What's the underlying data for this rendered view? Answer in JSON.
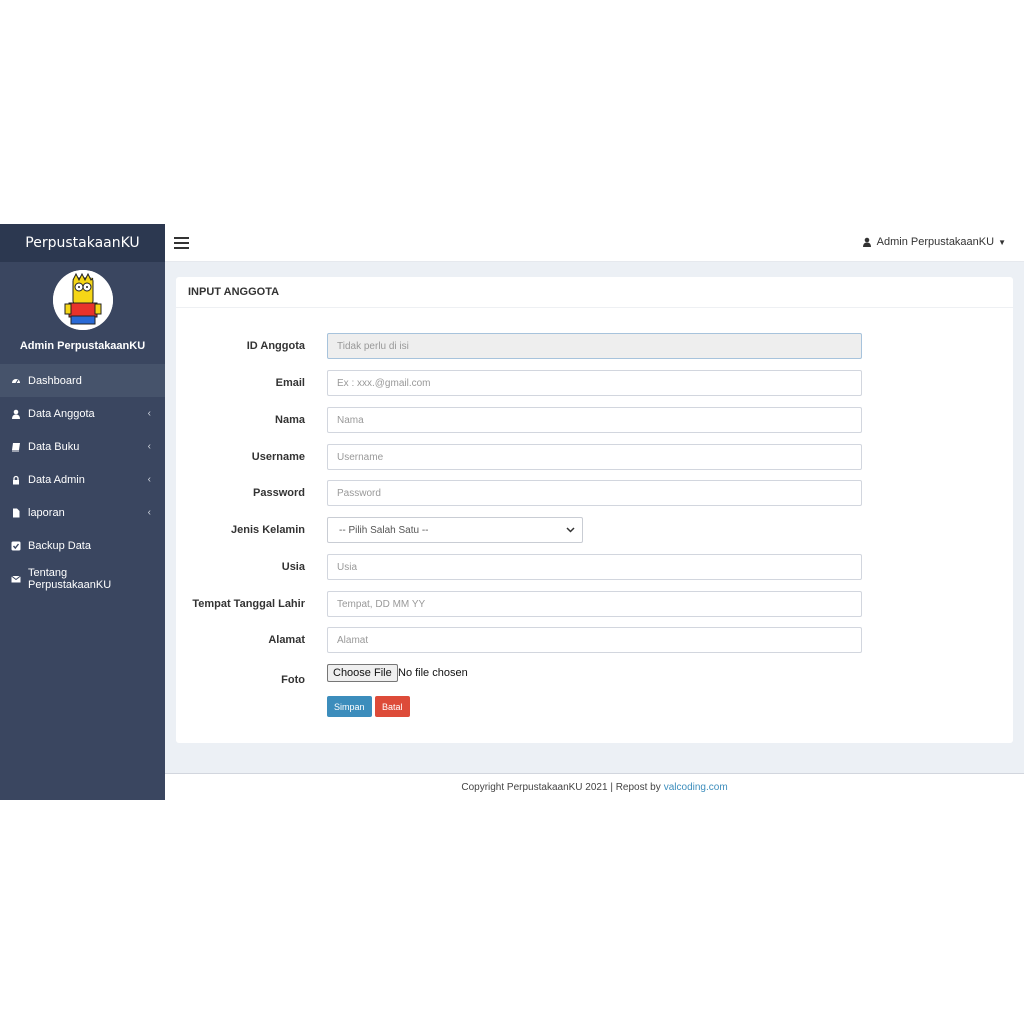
{
  "app": {
    "brand": "PerpustakaanKU"
  },
  "sidebar": {
    "user_name": "Admin PerpustakaanKU",
    "items": [
      {
        "label": "Dashboard",
        "icon": "dashboard-icon",
        "active": true,
        "submenu": false
      },
      {
        "label": "Data Anggota",
        "icon": "user-icon",
        "active": false,
        "submenu": true
      },
      {
        "label": "Data Buku",
        "icon": "book-icon",
        "active": false,
        "submenu": true
      },
      {
        "label": "Data Admin",
        "icon": "lock-icon",
        "active": false,
        "submenu": true
      },
      {
        "label": "laporan",
        "icon": "file-icon",
        "active": false,
        "submenu": true
      },
      {
        "label": "Backup Data",
        "icon": "check-square-icon",
        "active": false,
        "submenu": false
      },
      {
        "label": "Tentang PerpustakaanKU",
        "icon": "envelope-icon",
        "active": false,
        "submenu": false
      }
    ]
  },
  "topbar": {
    "user_label": "Admin PerpustakaanKU"
  },
  "form": {
    "title": "INPUT ANGGOTA",
    "fields": {
      "id_anggota": {
        "label": "ID Anggota",
        "placeholder": "Tidak perlu di isi"
      },
      "email": {
        "label": "Email",
        "placeholder": "Ex : xxx.@gmail.com"
      },
      "nama": {
        "label": "Nama",
        "placeholder": "Nama"
      },
      "username": {
        "label": "Username",
        "placeholder": "Username"
      },
      "password": {
        "label": "Password",
        "placeholder": "Password"
      },
      "jenis_kelamin": {
        "label": "Jenis Kelamin",
        "selected": "-- Pilih Salah Satu --"
      },
      "usia": {
        "label": "Usia",
        "placeholder": "Usia"
      },
      "ttl": {
        "label": "Tempat Tanggal Lahir",
        "placeholder": "Tempat, DD MM YY"
      },
      "alamat": {
        "label": "Alamat",
        "placeholder": "Alamat"
      },
      "foto": {
        "label": "Foto",
        "button": "Choose File",
        "status": "No file chosen"
      }
    },
    "buttons": {
      "save": "Simpan",
      "cancel": "Batal"
    }
  },
  "footer": {
    "text": "Copyright PerpustakaanKU 2021 | Repost by",
    "link": "valcoding.com"
  },
  "colors": {
    "sidebar": "#3a4660",
    "brand_bar": "#2c3850",
    "primary": "#3c8dbc",
    "danger": "#dd4b39"
  }
}
